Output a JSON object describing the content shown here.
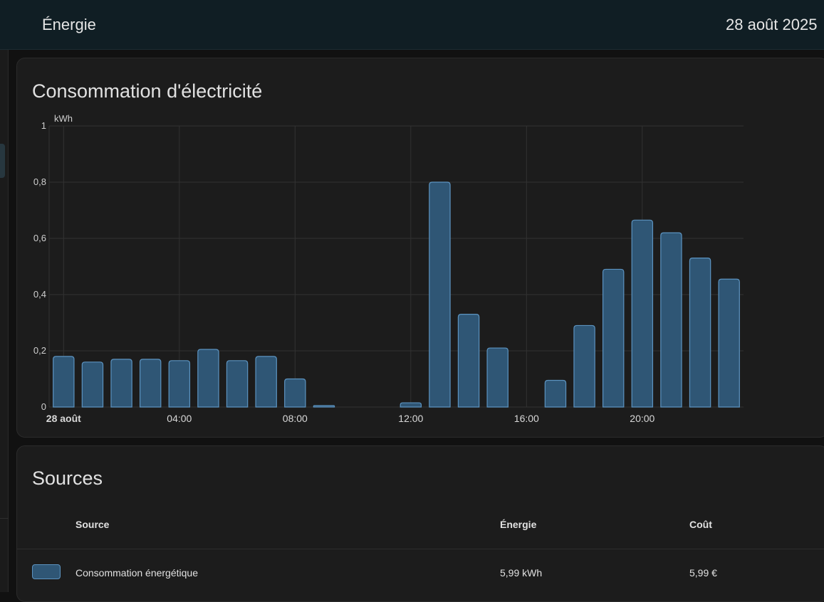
{
  "header": {
    "title": "Énergie",
    "date": "28 août 2025"
  },
  "chart_card": {
    "title": "Consommation d'électricité"
  },
  "chart_data": {
    "type": "bar",
    "ylabel": "kWh",
    "ylim": [
      0,
      1
    ],
    "yticks": [
      "0",
      "0,2",
      "0,4",
      "0,6",
      "0,8",
      "1"
    ],
    "xticks": [
      {
        "hour": 0,
        "label": "28 août",
        "bold": true
      },
      {
        "hour": 4,
        "label": "04:00",
        "bold": false
      },
      {
        "hour": 8,
        "label": "08:00",
        "bold": false
      },
      {
        "hour": 12,
        "label": "12:00",
        "bold": false
      },
      {
        "hour": 16,
        "label": "16:00",
        "bold": false
      },
      {
        "hour": 20,
        "label": "20:00",
        "bold": false
      }
    ],
    "categories": [
      "00:00",
      "01:00",
      "02:00",
      "03:00",
      "04:00",
      "05:00",
      "06:00",
      "07:00",
      "08:00",
      "09:00",
      "10:00",
      "11:00",
      "12:00",
      "13:00",
      "14:00",
      "15:00",
      "16:00",
      "17:00",
      "18:00",
      "19:00",
      "20:00",
      "21:00",
      "22:00",
      "23:00"
    ],
    "values": [
      0.18,
      0.16,
      0.17,
      0.17,
      0.165,
      0.205,
      0.165,
      0.18,
      0.1,
      0.005,
      0,
      0,
      0.015,
      0.8,
      0.33,
      0.21,
      0,
      0.095,
      0.29,
      0.49,
      0.665,
      0.62,
      0.53,
      0.455
    ],
    "grid": true,
    "colors": {
      "bar_fill": "#2f5675",
      "bar_stroke": "#5c93c0",
      "grid": "#323232"
    }
  },
  "sources_card": {
    "title": "Sources",
    "columns": {
      "source": "Source",
      "energy": "Énergie",
      "cost": "Coût"
    },
    "rows": [
      {
        "source": "Consommation énergétique",
        "energy": "5,99 kWh",
        "cost": "5,99 €",
        "color": "#2f5675"
      }
    ]
  }
}
